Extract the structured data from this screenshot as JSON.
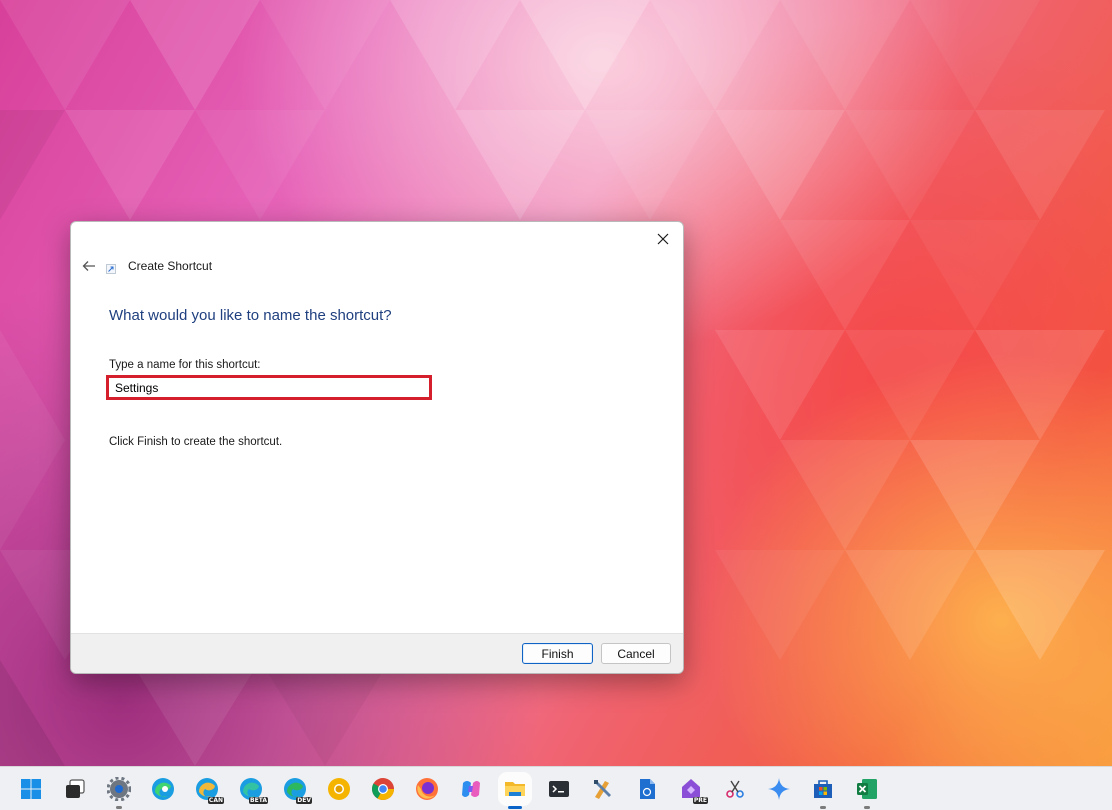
{
  "dialog": {
    "title": "Create Shortcut",
    "heading": "What would you like to name the shortcut?",
    "field_label": "Type a name for this shortcut:",
    "name_value": "Settings",
    "instruction": "Click Finish to create the shortcut.",
    "finish_label": "Finish",
    "cancel_label": "Cancel"
  },
  "taskbar": {
    "items": [
      {
        "name": "start-icon"
      },
      {
        "name": "task-view-icon"
      },
      {
        "name": "settings-gear-icon"
      },
      {
        "name": "edge-icon"
      },
      {
        "name": "edge-canary-icon",
        "badge": "CAN"
      },
      {
        "name": "edge-beta-icon",
        "badge": "BETA"
      },
      {
        "name": "edge-dev-icon",
        "badge": "DEV"
      },
      {
        "name": "chrome-canary-icon"
      },
      {
        "name": "chrome-icon"
      },
      {
        "name": "firefox-icon"
      },
      {
        "name": "copilot-icon"
      },
      {
        "name": "file-explorer-icon",
        "active": true
      },
      {
        "name": "terminal-icon"
      },
      {
        "name": "tools-icon"
      },
      {
        "name": "document-icon"
      },
      {
        "name": "power-automate-icon",
        "badge": "PRE"
      },
      {
        "name": "snipping-tool-icon"
      },
      {
        "name": "sparkle-icon"
      },
      {
        "name": "store-icon"
      },
      {
        "name": "excel-icon"
      }
    ]
  },
  "colors": {
    "accent": "#0a64c8",
    "highlight_border": "#d61f2c",
    "heading": "#1f3f7f"
  }
}
